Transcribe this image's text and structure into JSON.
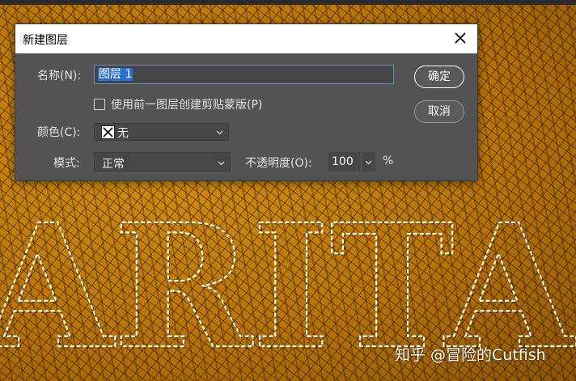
{
  "dialog": {
    "title": "新建图层",
    "name_label": "名称(N):",
    "name_value": "图层 1",
    "clip_checkbox_label": "使用前一图层创建剪贴蒙版(P)",
    "clip_checked": false,
    "color_label": "颜色(C):",
    "color_value": "无",
    "mode_label": "模式:",
    "mode_value": "正常",
    "opacity_label": "不透明度(O):",
    "opacity_value": "100",
    "opacity_unit": "%",
    "ok_label": "确定",
    "cancel_label": "取消"
  },
  "icons": {
    "close": "close-icon",
    "dropdown": "chevron-down-icon",
    "swatch": "no-color-swatch-icon"
  },
  "colors": {
    "dialog_bg": "#535353",
    "titlebar_bg": "#ffffff",
    "selection_highlight": "#2b6fd6"
  },
  "canvas": {
    "art_text": "ARITA",
    "watermark": "知乎 @冒险的Cutfish"
  }
}
